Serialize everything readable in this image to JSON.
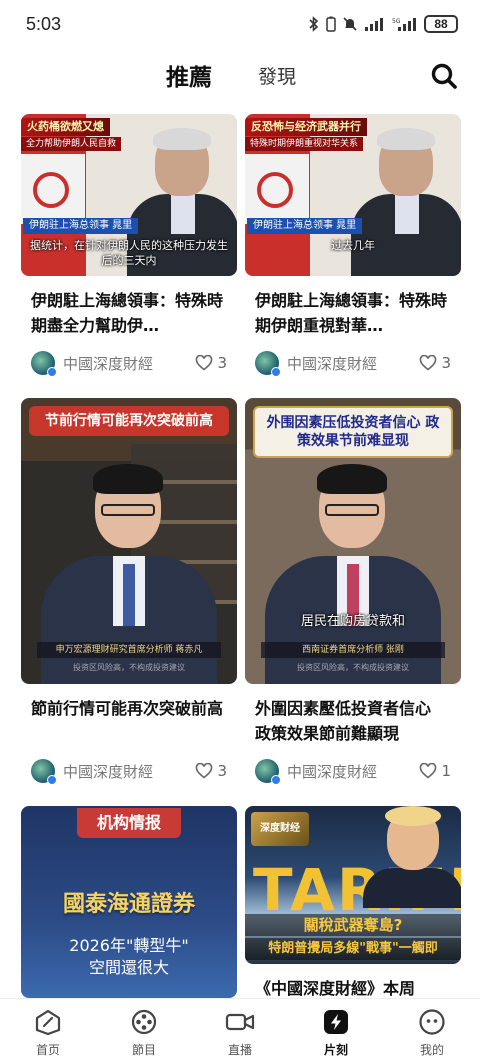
{
  "status_bar": {
    "time": "5:03",
    "battery": "88"
  },
  "header": {
    "tabs": [
      {
        "label": "推薦",
        "active": true
      },
      {
        "label": "發現",
        "active": false
      }
    ]
  },
  "cards": [
    {
      "title": "伊朗駐上海總領事：特殊時期盡全力幫助伊…",
      "author": "中國深度財經",
      "likes": "3",
      "thumb": {
        "banner": "火药桶欲燃又熄",
        "banner_sub": "全力帮助伊朗人民自救",
        "lower_third": "伊朗驻上海总领事 晁里",
        "subtitle": "据统计，在针对伊朗人民的这种压力发生后的三天内"
      }
    },
    {
      "title": "伊朗駐上海總領事：特殊時期伊朗重視對華…",
      "author": "中國深度財經",
      "likes": "3",
      "thumb": {
        "banner": "反恐怖与经济武器并行",
        "banner_sub": "特殊时期伊朗重视对华关系",
        "lower_third": "伊朗驻上海总领事 晁里",
        "subtitle": "过去几年"
      }
    },
    {
      "title": "節前行情可能再次突破前高",
      "author": "中國深度財經",
      "likes": "3",
      "thumb": {
        "banner": "节前行情可能再次突破前高",
        "caption": "",
        "name_bar": "申万宏源理财研究首席分析师 蒋赤凡",
        "disclaimer": "投资区风险高，不构成投资建议"
      }
    },
    {
      "title": "外圍因素壓低投資者信心 政策效果節前難顯現",
      "author": "中國深度財經",
      "likes": "1",
      "thumb": {
        "banner": "外围因素压低投资者信心 政策效果节前难显现",
        "caption": "居民在购房贷款和",
        "name_bar": "西南证券首席分析师 张刚",
        "disclaimer": "投资区风险高，不构成投资建议"
      }
    },
    {
      "title": "",
      "thumb": {
        "tag": "机构情报",
        "brand": "國泰海通證券",
        "line1": "2026年\"轉型牛\"",
        "line2": "空間還很大"
      }
    },
    {
      "title": "《中國深度財經》本周",
      "thumb": {
        "logo": "深度财经",
        "big": "TARIFF",
        "head1": "關稅武器奪島?",
        "head2": "特朗普攪局多線\"戰事\"一觸即"
      }
    }
  ],
  "bottom_nav": [
    {
      "label": "首页",
      "icon": "home-icon",
      "active": false
    },
    {
      "label": "節目",
      "icon": "film-reel-icon",
      "active": false
    },
    {
      "label": "直播",
      "icon": "video-camera-icon",
      "active": false
    },
    {
      "label": "片刻",
      "icon": "lightning-icon",
      "active": true
    },
    {
      "label": "我的",
      "icon": "profile-icon",
      "active": false
    }
  ]
}
